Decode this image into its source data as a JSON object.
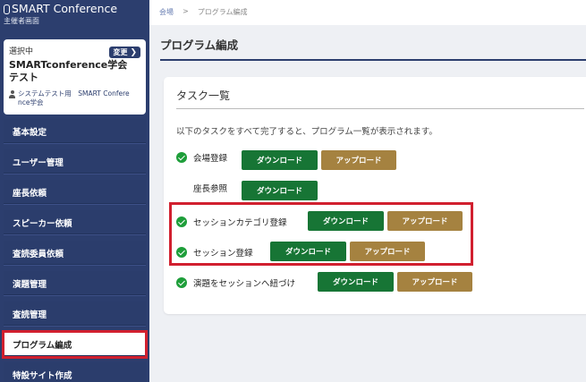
{
  "brand": {
    "title": "SMART Conference",
    "subtitle": "主催者画面"
  },
  "selected": {
    "label": "選択中",
    "change_label": "変更",
    "conference_name": "SMARTconference学会　テスト",
    "user_line1": "システムテスト用　SMART Confere",
    "user_line2": "nce学会"
  },
  "menu": [
    {
      "label": "基本設定"
    },
    {
      "label": "ユーザー管理"
    },
    {
      "label": "座長依頼"
    },
    {
      "label": "スピーカー依頼"
    },
    {
      "label": "査読委員依頼"
    },
    {
      "label": "演題管理"
    },
    {
      "label": "査読管理"
    },
    {
      "label": "プログラム編成"
    },
    {
      "label": "特設サイト作成"
    }
  ],
  "breadcrumb": {
    "home": "会場",
    "separator": ">",
    "current": "プログラム編成"
  },
  "page_title": "プログラム編成",
  "card": {
    "title": "タスク一覧",
    "intro": "以下のタスクをすべて完了すると、プログラム一覧が表示されます。"
  },
  "tasks": [
    {
      "label": "会場登録",
      "done": true,
      "download": "ダウンロード",
      "upload": "アップロード"
    },
    {
      "label": "座長参照",
      "done": false,
      "download": "ダウンロード"
    },
    {
      "label": "セッションカテゴリ登録",
      "done": true,
      "download": "ダウンロード",
      "upload": "アップロード"
    },
    {
      "label": "セッション登録",
      "done": true,
      "download": "ダウンロード",
      "upload": "アップロード"
    },
    {
      "label": "演題をセッションへ紐づけ",
      "done": true,
      "download": "ダウンロード",
      "upload": "アップロード"
    }
  ],
  "colors": {
    "sidebar": "#2c3e6e",
    "download": "#177535",
    "upload": "#a58240",
    "highlight": "#d1202f",
    "check": "#1e9e3a"
  }
}
